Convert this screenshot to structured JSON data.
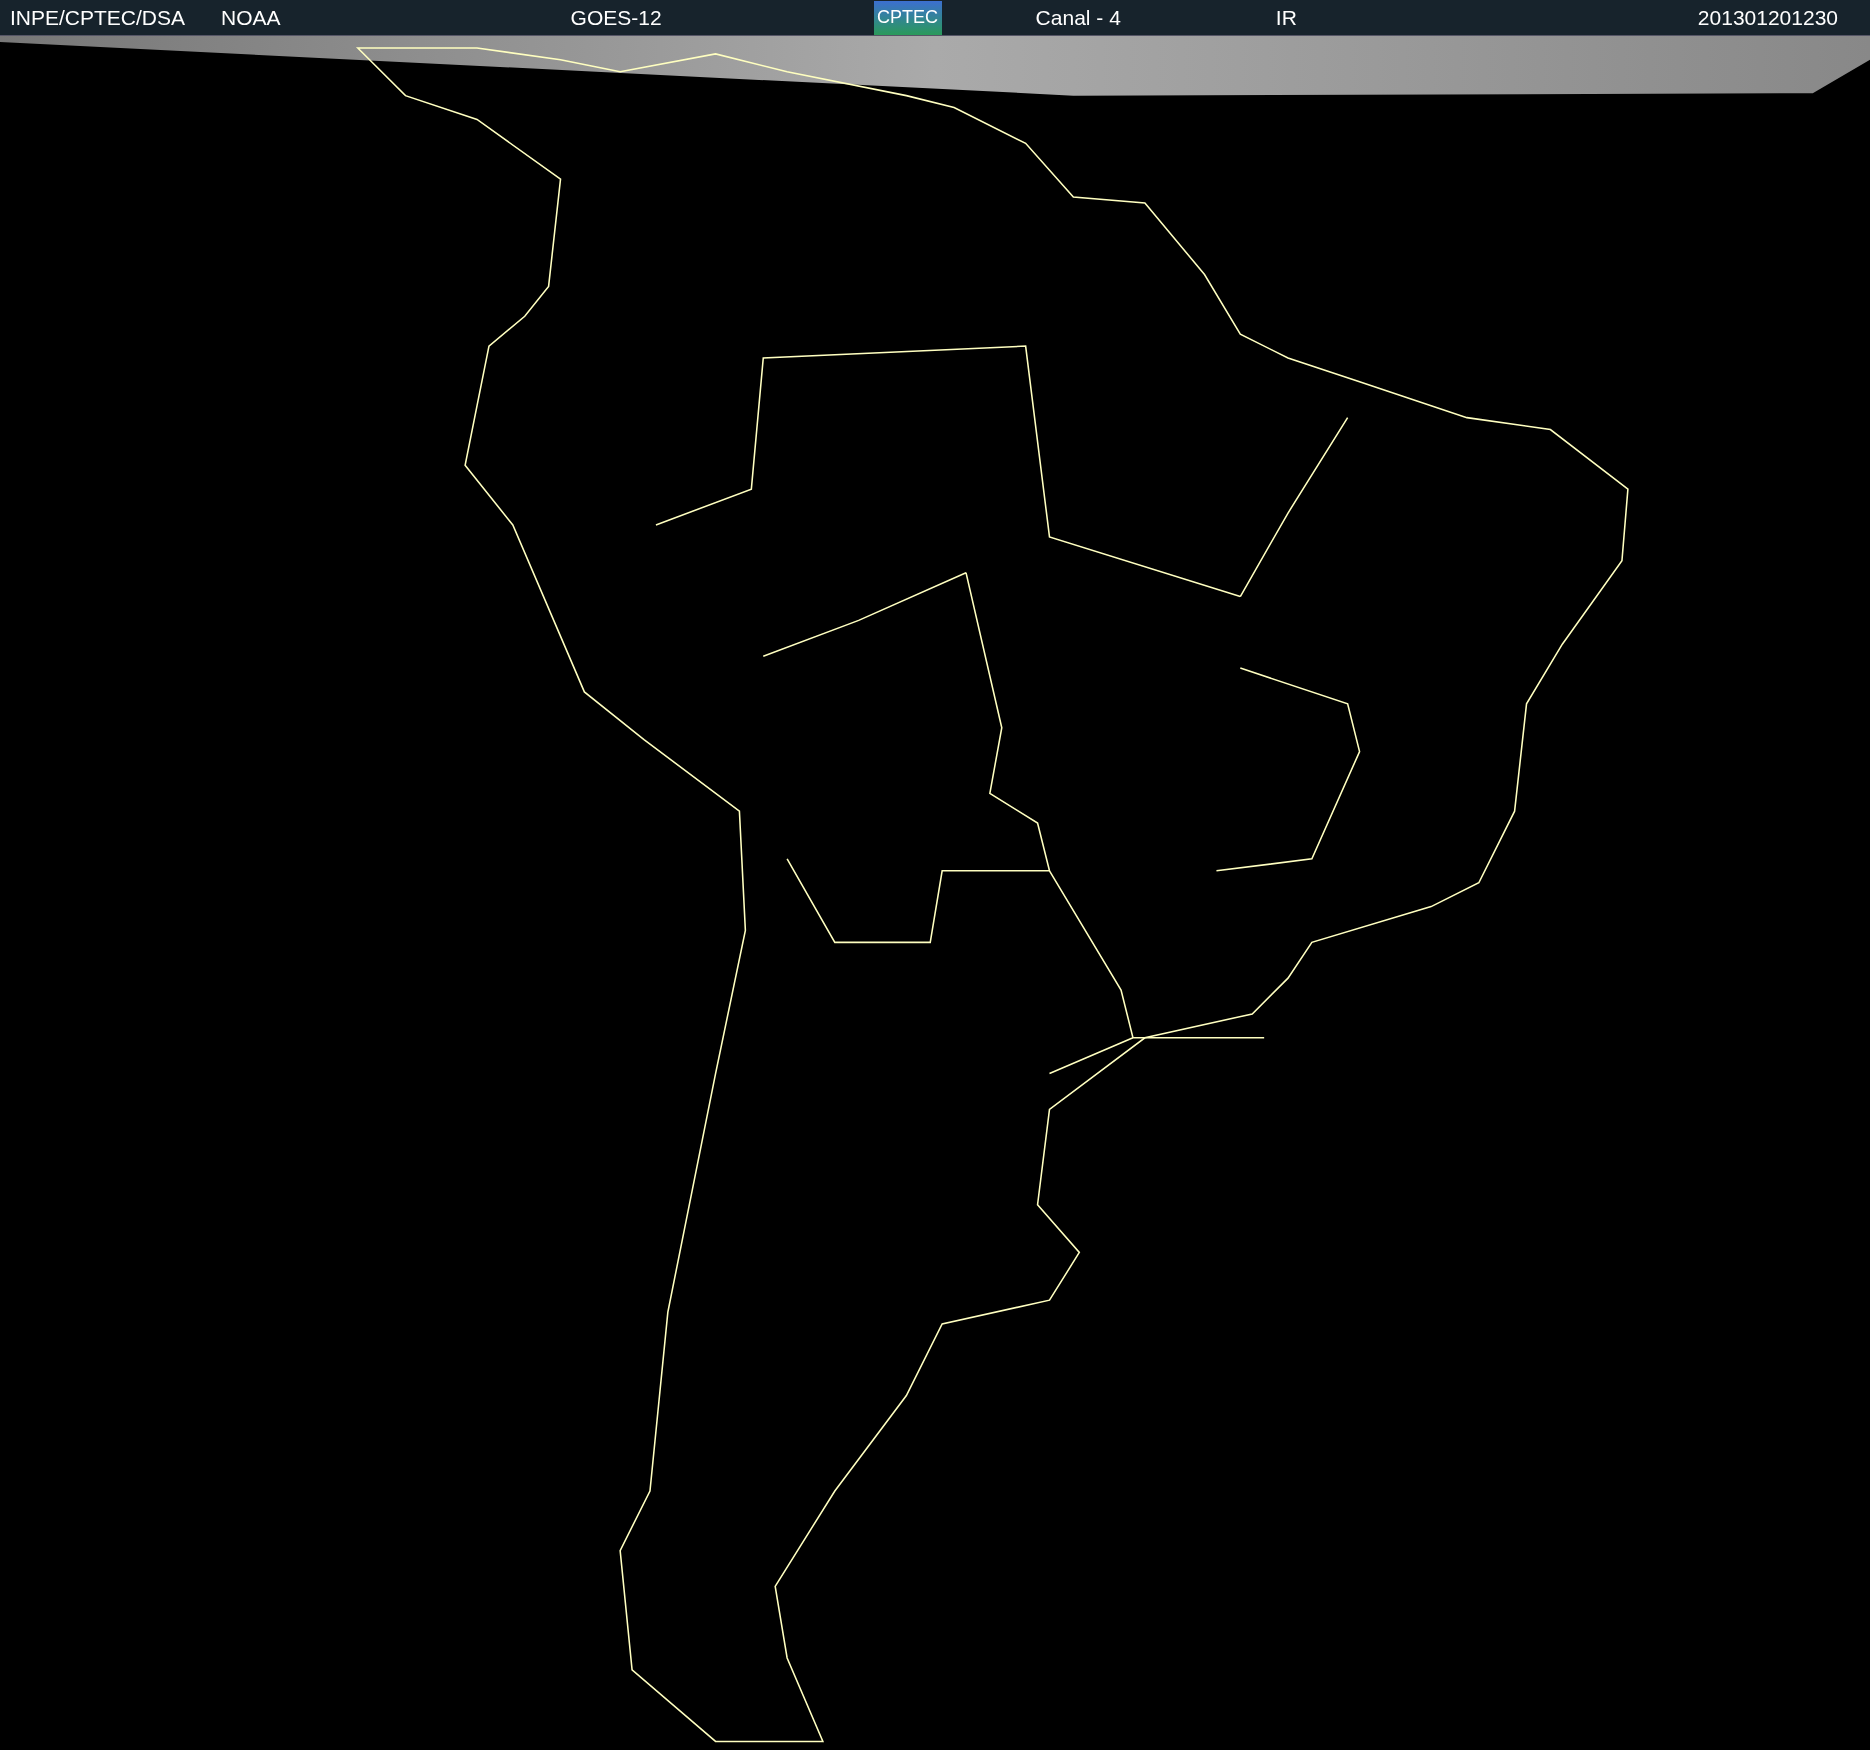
{
  "header": {
    "agency": "INPE/CPTEC/DSA",
    "source": "NOAA",
    "satellite": "GOES-12",
    "logo_text": "CPTEC",
    "channel": "Canal - 4",
    "band": "IR",
    "timestamp": "201301201230"
  }
}
